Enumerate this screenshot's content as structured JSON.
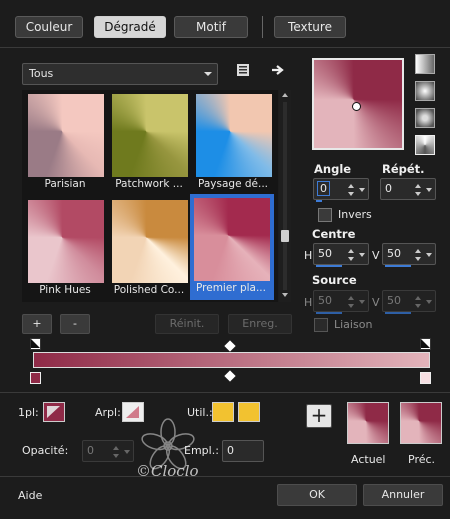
{
  "tabs": [
    "Couleur",
    "Dégradé",
    "Motif",
    "Texture"
  ],
  "preset_select": "Tous",
  "thumbnails": [
    {
      "label": "Parisian",
      "colors": [
        "#9a7b86",
        "#f4c8c0",
        "#e7b9b4"
      ]
    },
    {
      "label": "Patchwork ...",
      "colors": [
        "#6f7a1e",
        "#c9c46b",
        "#97963f"
      ]
    },
    {
      "label": "Paysage dé...",
      "colors": [
        "#1d8ee6",
        "#f2c7b0",
        "#7fbbe8"
      ]
    },
    {
      "label": "Pink Hues",
      "colors": [
        "#eac6cc",
        "#b24a64",
        "#d08c9c"
      ]
    },
    {
      "label": "Polished Co...",
      "colors": [
        "#f2d4b5",
        "#c98a3e",
        "#fff1de"
      ]
    },
    {
      "label": "Premier pla...",
      "colors": [
        "#d88e9b",
        "#a32a4e",
        "#e6b2ba"
      ]
    }
  ],
  "buttons": {
    "add": "+",
    "remove": "-",
    "reset": "Réinit.",
    "save": "Enreg.",
    "ok": "OK",
    "cancel": "Annuler",
    "help": "Aide"
  },
  "angle": {
    "label": "Angle",
    "value": "0"
  },
  "repeat": {
    "label": "Répét.",
    "value": "0"
  },
  "invert_label": "Invers",
  "center": {
    "label": "Centre",
    "h_label": "H",
    "h_value": "50",
    "v_label": "V",
    "v_value": "50"
  },
  "source": {
    "label": "Source",
    "h_label": "H",
    "h_value": "50",
    "v_label": "V",
    "v_value": "50"
  },
  "link_label": "Liaison",
  "gradient": {
    "start_color": "#8f2a47",
    "end_color": "#e3b4bb"
  },
  "opacity_label": "1pl:",
  "arpl_label": "Arpl:",
  "util_label": "Util.:",
  "opacite": {
    "label": "Opacité:",
    "value": "0"
  },
  "empl": {
    "label": "Empl.:",
    "value": "0"
  },
  "actuel_label": "Actuel",
  "prec_label": "Préc.",
  "watermark": "©Cloclo",
  "colors": {
    "start_swatch": "#8f2a47",
    "util_swatch": "#f2c230"
  }
}
